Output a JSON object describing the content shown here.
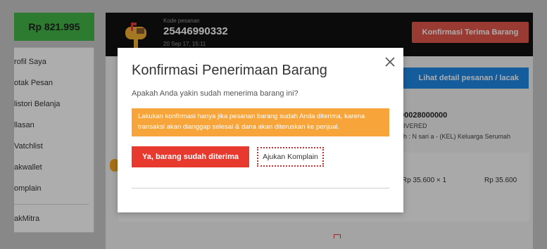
{
  "sidebar": {
    "balance": "Rp 821.995",
    "items": [
      {
        "label": "rofil Saya"
      },
      {
        "label": "otak Pesan"
      },
      {
        "label": "listori Belanja"
      },
      {
        "label": "llasan"
      },
      {
        "label": "Vatchlist"
      },
      {
        "label": "akwallet"
      },
      {
        "label": "omplain"
      },
      {
        "label": "akMitra"
      }
    ]
  },
  "order": {
    "code_label": "Kode pesanan",
    "code": "25446990332",
    "date": "20 Sep 17, 15:11",
    "confirm_button": "Konfirmasi Terima Barang",
    "detail_button": "Lihat detail pesanan / lacak",
    "invoice_fragment": "00028000000",
    "status_fragment": "LIVERED",
    "shipping_fragment": "eh : N sari a - (KEL) Keluarga Serumah",
    "qty_price": "Rp 35.600 × 1",
    "total_price": "Rp 35.600"
  },
  "modal": {
    "title": "Konfirmasi Penerimaan Barang",
    "question": "Apakah Anda yakin sudah menerima barang ini?",
    "warning_line1": "Lakukan konfirmasi hanya jika pesanan barang sudah Anda diterima, karena",
    "warning_line2": "transaksi akan dianggap selesai & dana akan diteruskan ke penjual.",
    "confirm_label": "Ya, barang sudah diterima",
    "complain_label": "Ajukan Komplain",
    "close_icon": "close-icon"
  },
  "colors": {
    "brand_green": "#42b549",
    "confirm_red": "#e8392e",
    "warning_orange": "#f7a43b",
    "detail_blue": "#1e88e5"
  }
}
